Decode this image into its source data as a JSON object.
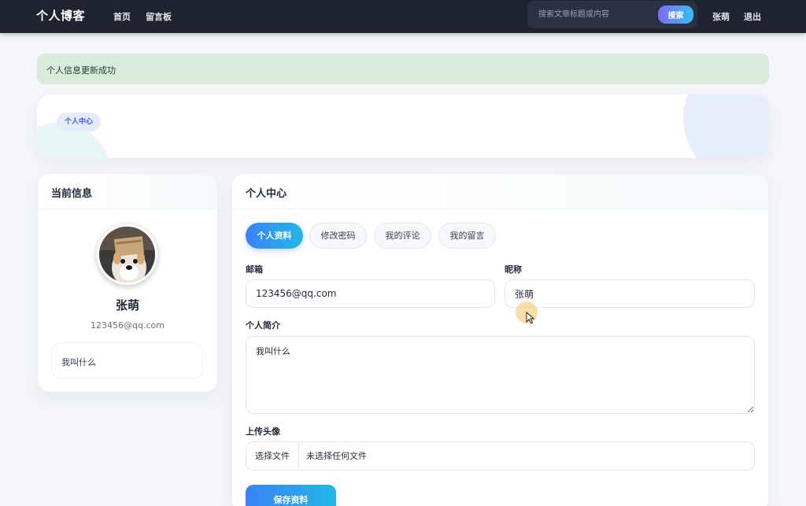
{
  "nav": {
    "brand": "个人博客",
    "links": [
      "首页",
      "留言板"
    ],
    "search_placeholder": "搜索文章标题或内容",
    "search_button": "搜索",
    "user_name": "张萌",
    "logout": "退出"
  },
  "alert": {
    "message": "个人信息更新成功"
  },
  "banner": {
    "chip": "个人中心"
  },
  "profile_card": {
    "title": "当前信息",
    "name": "张萌",
    "email": "123456@qq.com",
    "bio": "我叫什么",
    "avatar": "dog-avatar-image"
  },
  "main_card": {
    "title": "个人中心",
    "tabs": [
      "个人资料",
      "修改密码",
      "我的评论",
      "我的留言"
    ],
    "active_tab": "个人资料",
    "form": {
      "email_label": "邮箱",
      "email_value": "123456@qq.com",
      "nickname_label": "昵称",
      "nickname_value": "张萌",
      "bio_label": "个人简介",
      "bio_value": "我叫什么",
      "avatar_label": "上传头像",
      "file_button": "选择文件",
      "file_status": "未选择任何文件",
      "save_button": "保存资料"
    }
  },
  "colors": {
    "nav_bg": "#1e2330",
    "accent_start": "#3b82f6",
    "accent_end": "#22b8e6",
    "alert_bg": "#d8ebdd"
  }
}
